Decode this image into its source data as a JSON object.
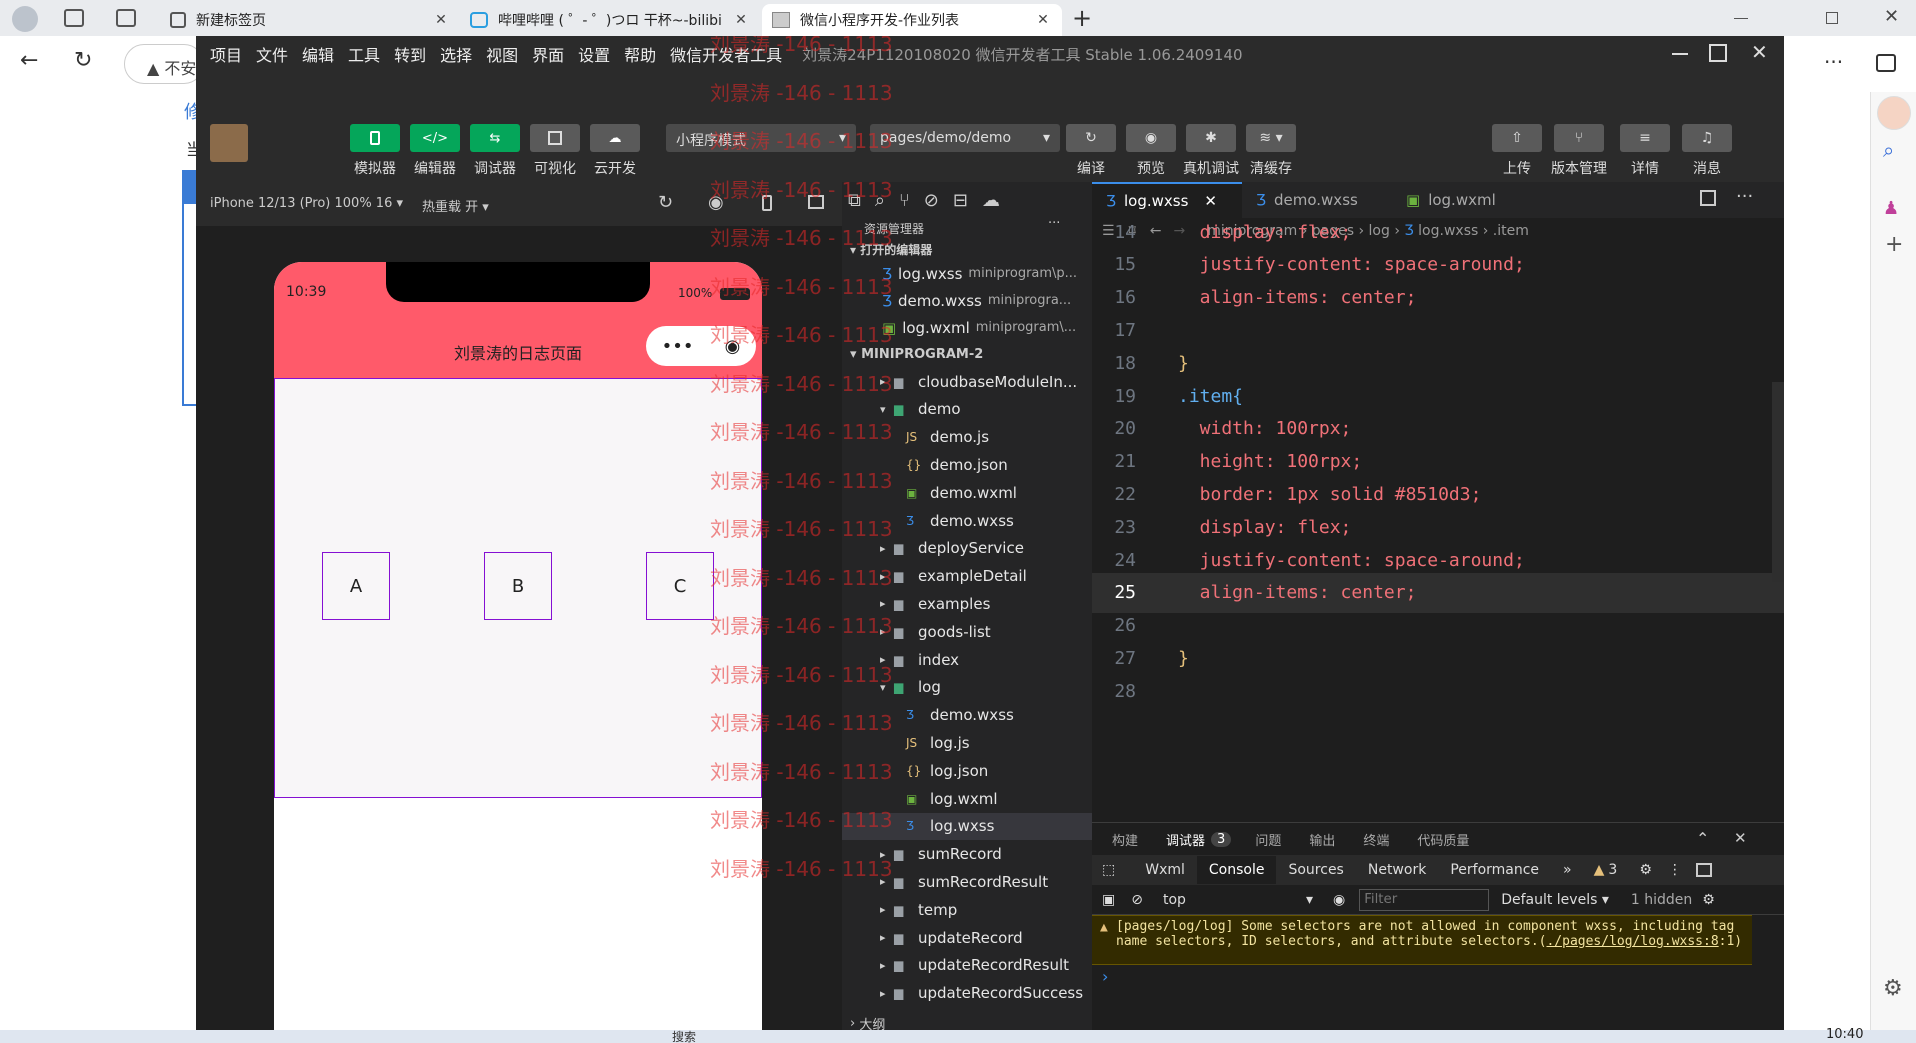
{
  "browser": {
    "tabs": [
      {
        "label": "新建标签页",
        "close": "✕"
      },
      {
        "label": "哔哩哔哩 ( ゜- ゜)つロ 干杯~-bilibi",
        "close": "✕"
      },
      {
        "label": "微信小程序开发-作业列表",
        "close": "✕"
      }
    ],
    "new_tab": "+",
    "address_prefix": "不安",
    "page_partial_text": "修",
    "page_partial_text2": "当",
    "more": "···"
  },
  "devtools": {
    "menu": [
      "项目",
      "文件",
      "编辑",
      "工具",
      "转到",
      "选择",
      "视图",
      "界面",
      "设置",
      "帮助",
      "微信开发者工具"
    ],
    "title": "刘景涛24P1120108020  微信开发者工具 Stable 1.06.2409140",
    "toolbar": {
      "simulator": "模拟器",
      "editor": "编辑器",
      "debugger": "调试器",
      "visual": "可视化",
      "cloud": "云开发",
      "mode": "小程序模式",
      "page": "pages/demo/demo",
      "compile": "编译",
      "preview": "预览",
      "real_debug": "真机调试",
      "clear_cache": "清缓存",
      "upload": "上传",
      "version": "版本管理",
      "details": "详情",
      "messages": "消息"
    },
    "sim_bar": {
      "device": "iPhone 12/13 (Pro) 100% 16 ▾",
      "hotreload": "热重载 开 ▾"
    },
    "phone": {
      "time": "10:39",
      "battery": "100%",
      "nav_title": "刘景涛的日志页面",
      "nav_color": "#ff5a6a",
      "border_color": "#8510d3",
      "items": [
        "A",
        "B",
        "C"
      ]
    },
    "explorer": {
      "title": "资源管理器",
      "more": "···",
      "open_editors": "打开的编辑器",
      "open_files": [
        {
          "name": "log.wxss",
          "path": "miniprogram\\p..."
        },
        {
          "name": "demo.wxss",
          "path": "miniprogra..."
        },
        {
          "name": "log.wxml",
          "path": "miniprogram\\..."
        }
      ],
      "root": "MINIPROGRAM-2",
      "tree": [
        {
          "name": "cloudbaseModuleIn...",
          "type": "folder",
          "depth": 1
        },
        {
          "name": "demo",
          "type": "folder-open",
          "depth": 1
        },
        {
          "name": "demo.js",
          "type": "js",
          "depth": 2
        },
        {
          "name": "demo.json",
          "type": "json",
          "depth": 2
        },
        {
          "name": "demo.wxml",
          "type": "wxml",
          "depth": 2
        },
        {
          "name": "demo.wxss",
          "type": "wxss",
          "depth": 2
        },
        {
          "name": "deployService",
          "type": "folder",
          "depth": 1
        },
        {
          "name": "exampleDetail",
          "type": "folder",
          "depth": 1
        },
        {
          "name": "examples",
          "type": "folder",
          "depth": 1
        },
        {
          "name": "goods-list",
          "type": "folder",
          "depth": 1
        },
        {
          "name": "index",
          "type": "folder",
          "depth": 1
        },
        {
          "name": "log",
          "type": "folder-open",
          "depth": 1
        },
        {
          "name": "demo.wxss",
          "type": "wxss",
          "depth": 2
        },
        {
          "name": "log.js",
          "type": "js",
          "depth": 2
        },
        {
          "name": "log.json",
          "type": "json",
          "depth": 2
        },
        {
          "name": "log.wxml",
          "type": "wxml",
          "depth": 2
        },
        {
          "name": "log.wxss",
          "type": "wxss",
          "depth": 2,
          "selected": true
        },
        {
          "name": "sumRecord",
          "type": "folder",
          "depth": 1
        },
        {
          "name": "sumRecordResult",
          "type": "folder",
          "depth": 1
        },
        {
          "name": "temp",
          "type": "folder",
          "depth": 1
        },
        {
          "name": "updateRecord",
          "type": "folder",
          "depth": 1
        },
        {
          "name": "updateRecordResult",
          "type": "folder",
          "depth": 1
        },
        {
          "name": "updateRecordSuccess",
          "type": "folder",
          "depth": 1
        }
      ],
      "outline": "大纲"
    },
    "editor": {
      "tabs": [
        {
          "name": "log.wxss",
          "active": true,
          "close": "✕"
        },
        {
          "name": "demo.wxss",
          "active": false
        },
        {
          "name": "log.wxml",
          "active": false
        }
      ],
      "breadcrumb": [
        "miniprogram",
        "pages",
        "log",
        "log.wxss",
        ".item"
      ],
      "lines": [
        {
          "n": "14",
          "text": "  display: flex;"
        },
        {
          "n": "15",
          "text": "  justify-content: space-around;"
        },
        {
          "n": "16",
          "text": "  align-items: center;"
        },
        {
          "n": "17",
          "text": ""
        },
        {
          "n": "18",
          "text": "}"
        },
        {
          "n": "19",
          "text": ".item{"
        },
        {
          "n": "20",
          "text": "  width: 100rpx;"
        },
        {
          "n": "21",
          "text": "  height: 100rpx;"
        },
        {
          "n": "22",
          "text": "  border: 1px solid #8510d3;"
        },
        {
          "n": "23",
          "text": "  display: flex;"
        },
        {
          "n": "24",
          "text": "  justify-content: space-around;"
        },
        {
          "n": "25",
          "text": "  align-items: center;"
        },
        {
          "n": "26",
          "text": ""
        },
        {
          "n": "27",
          "text": "}"
        },
        {
          "n": "28",
          "text": ""
        }
      ]
    },
    "console": {
      "panel_tabs": [
        "构建",
        "调试器",
        "问题",
        "输出",
        "终端",
        "代码质量"
      ],
      "debugger_badge": "3",
      "tabs": [
        "Wxml",
        "Console",
        "Sources",
        "Network",
        "Performance"
      ],
      "more_tabs": "»",
      "warn_count": "3",
      "context": "top",
      "filter_placeholder": "Filter",
      "levels": "Default levels ▾",
      "hidden": "1 hidden",
      "warning": "[pages/log/log] Some selectors are not allowed in component wxss, including tag name selectors, ID selectors, and attribute selectors.(",
      "warning_link": "./pages/log/log.wxss:8",
      "warning_tail": ":1)",
      "prompt": "›"
    },
    "watermark": "刘景涛 -146 - 1113"
  },
  "taskbar": {
    "search": "搜索",
    "time": "10:40"
  }
}
